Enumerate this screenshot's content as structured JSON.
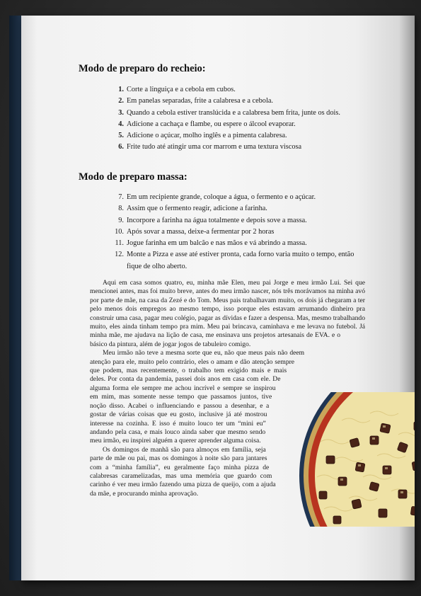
{
  "recheio": {
    "title": "Modo de preparo do recheio:",
    "steps": [
      {
        "n": "1.",
        "t": "Corte a linguiça e a cebola em cubos."
      },
      {
        "n": "2.",
        "t": "Em panelas separadas, frite a calabresa e a cebola."
      },
      {
        "n": "3.",
        "t": "Quando a cebola estiver translúcida e a calabresa bem frita, junte os dois."
      },
      {
        "n": "4.",
        "t": "Adicione a cachaça e flambe, ou espere o álcool evaporar."
      },
      {
        "n": "5.",
        "t": "Adicione o açúcar, molho inglês e a pimenta calabresa."
      },
      {
        "n": "6.",
        "t": "Frite tudo até atingir uma cor marrom e uma textura viscosa"
      }
    ]
  },
  "massa": {
    "title": "Modo de preparo massa:",
    "steps": [
      {
        "n": "7.",
        "t": "Em um recipiente grande, coloque a água, o fermento e o açúcar."
      },
      {
        "n": "8.",
        "t": "Assim que o fermento reagir, adicione a farinha."
      },
      {
        "n": "9.",
        "t": "Incorpore a farinha na água totalmente e depois sove a massa."
      },
      {
        "n": "10.",
        "t": "Após sovar a massa, deixe-a fermentar por 2 horas"
      },
      {
        "n": "11.",
        "t": "Jogue farinha em um balcão e nas mãos e vá abrindo a massa."
      },
      {
        "n": "12.",
        "t": "Monte a Pizza e asse até estiver pronta, cada forno varia muito o tempo, então fique de olho aberto."
      }
    ]
  },
  "story": {
    "p1": "Aqui em casa somos quatro, eu, minha mãe Elen, meu pai Jorge e meu irmão Lui. Sei que mencionei antes, mas foi muito breve, antes do meu irmão nascer, nós três morávamos na minha avó por parte de mãe, na casa da Zezé e do Tom. Meus pais trabalhavam muito, os dois já chegaram a ter pelo menos dois empregos ao mesmo tempo, isso porque eles estavam arrumando dinheiro pra construir uma casa, pagar meu colégio, pagar as dívidas e fazer a despensa. Mas, mesmo trabalhando muito, eles ainda tinham tempo pra mim. Meu pai brincava, caminhava e me levava no futebol. Já minha mãe, me ajudava na lição de casa, me ensinava uns projetos artesanais de EVA. e o básico da pintura, além de jogar jogos de tabuleiro comigo.",
    "p2": "Meu irmão não teve a mesma sorte que eu, não que meus pais não deem atenção para ele, muito pelo contrário, eles o amam e dão atenção sempre que podem, mas recentemente, o trabalho tem exigido mais e mais deles. Por conta da pandemia, passei dois anos em casa com ele. De alguma forma ele sempre me achou incrível e sempre se inspirou em mim, mas somente nesse tempo que passamos juntos, tive noção disso. Acabei o influenciando e passou a desenhar, e a gostar de várias coisas que eu gosto, inclusive já até mostrou interesse na cozinha. E isso é muito louco ter um “mini eu” andando pela casa, e mais louco ainda saber que mesmo sendo meu irmão, eu inspirei alguém a querer aprender alguma coisa.",
    "p3": "Os domingos de manhã são para almoços em família, seja parte de mãe ou pai, mas os domingos à noite são para jantares com a “minha família”, eu geralmente faço minha pizza de calabresas caramelizadas, mas uma memória que guardo com carinho é ver meu irmão fazendo uma pizza de queijo, com a ajuda da mãe, e procurando minha aprovação."
  },
  "colors": {
    "spine": "#1b2c40",
    "paper": "#f4f4f4",
    "text": "#1a1a1a",
    "sauce": "#b8331f",
    "cheese": "#efe2a6",
    "crust": "#1f3552"
  },
  "icons": {
    "illustration": "pizza-calabresa"
  }
}
